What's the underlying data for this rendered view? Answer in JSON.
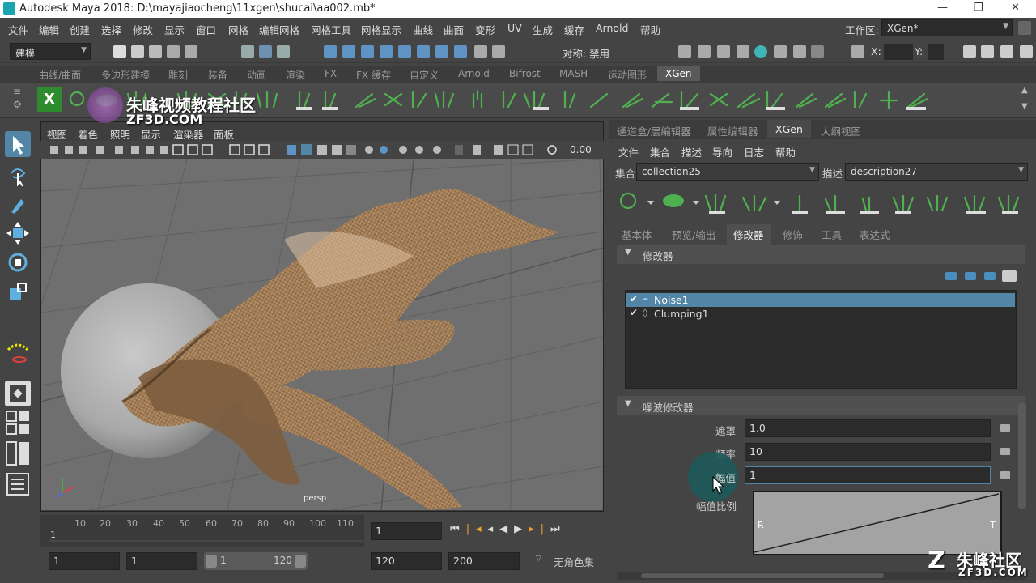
{
  "window": {
    "title": "Autodesk Maya 2018: D:\\mayajiaocheng\\11xgen\\shucai\\aa002.mb*",
    "controls": [
      "—",
      "❐",
      "✕"
    ]
  },
  "menubar": {
    "items": [
      "文件",
      "编辑",
      "创建",
      "选择",
      "修改",
      "显示",
      "窗口",
      "网格",
      "编辑网格",
      "网格工具",
      "网格显示",
      "曲线",
      "曲面",
      "变形",
      "UV",
      "生成",
      "缓存",
      "Arnold",
      "帮助"
    ],
    "workspace_label": "工作区:",
    "workspace_value": "XGen*"
  },
  "statusline": {
    "mode": "建模",
    "symmetry": "对称: 禁用",
    "x_label": "X:",
    "y_label": "Y:"
  },
  "shelf_tabs": [
    "曲线/曲面",
    "多边形建模",
    "雕刻",
    "装备",
    "动画",
    "渲染",
    "FX",
    "FX 缓存",
    "自定义",
    "Arnold",
    "Bifrost",
    "MASH",
    "运动图形",
    "XGen"
  ],
  "shelf_active": "XGen",
  "viewport": {
    "menu": [
      "视图",
      "着色",
      "照明",
      "显示",
      "渲染器",
      "面板"
    ],
    "exposure": "0.00",
    "camera": "persp"
  },
  "watermark": {
    "top_text": "朱峰视频教程社区",
    "top_url": "ZF3D.COM",
    "bottom_text": "朱峰社区",
    "bottom_url": "ZF3D.COM"
  },
  "timeline": {
    "ticks": [
      "1",
      "10",
      "20",
      "30",
      "40",
      "50",
      "60",
      "70",
      "80",
      "90",
      "100",
      "110"
    ],
    "current_frame": "1"
  },
  "range": {
    "start": "1",
    "anim_start": "1",
    "slider_start": "1",
    "slider_end": "120",
    "end": "120",
    "anim_end": "200",
    "charset": "无角色集"
  },
  "rpanel": {
    "tabs": [
      "通道盒/层编辑器",
      "属性编辑器",
      "XGen",
      "大纲视图"
    ],
    "active_tab": "XGen",
    "menu": [
      "文件",
      "集合",
      "描述",
      "导向",
      "日志",
      "帮助"
    ],
    "collection_label": "集合",
    "collection_value": "collection25",
    "description_label": "描述",
    "description_value": "description27",
    "subtabs": [
      "基本体",
      "预览/输出",
      "修改器",
      "修饰",
      "工具",
      "表达式"
    ],
    "active_subtab": "修改器",
    "modifiers_header": "修改器",
    "modifiers": [
      {
        "name": "Noise1",
        "checked": true,
        "selected": true
      },
      {
        "name": "Clumping1",
        "checked": true,
        "selected": false
      }
    ],
    "noise_header": "噪波修改器",
    "fields": [
      {
        "label": "遮罩",
        "value": "1.0"
      },
      {
        "label": "频率",
        "value": "10"
      },
      {
        "label": "幅值",
        "value": "1"
      }
    ],
    "ramp_label": "幅值比例",
    "ramp_r": "R",
    "ramp_t": "T"
  },
  "colors": {
    "accent": "#5285a6",
    "selected_row": "#5285a6",
    "fur": "#b08860",
    "sphere": "#b9b9b9",
    "shelf_green": "#4fb04f"
  }
}
